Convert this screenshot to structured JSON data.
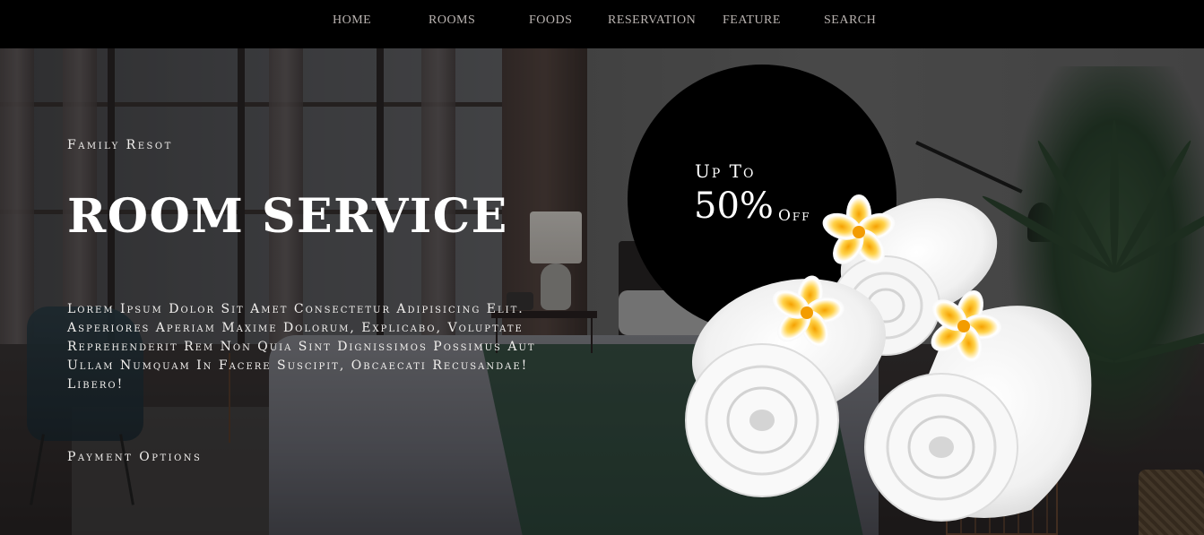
{
  "nav": {
    "items": [
      {
        "label": "HOME"
      },
      {
        "label": "ROOMS"
      },
      {
        "label": "FOODS"
      },
      {
        "label": "RESERVATION"
      },
      {
        "label": "FEATURE"
      },
      {
        "label": "SEARCH"
      }
    ]
  },
  "hero": {
    "eyebrow": "Family Resot",
    "headline": "ROOM SERVICE",
    "body": "Lorem Ipsum Dolor Sit Amet Consectetur Adipisicing Elit. Asperiores Aperiam Maxime Dolorum, Explicabo, Voluptate Reprehenderit Rem Non Quia Sint Dignissimos Possimus Aut Ullam Numquam In Facere Suscipit, Obcaecati Recusandae! Libero!",
    "payment_link": "Payment Options"
  },
  "promo": {
    "up_to": "Up To",
    "percent": "50%",
    "off": "Off"
  },
  "colors": {
    "nav_background": "#000000",
    "nav_text": "#b9b3b0",
    "promo_circle": "#000000",
    "text": "#ffffff"
  },
  "icons": {
    "promo_image": "rolled-towels-with-frangipani-flowers",
    "background_image": "hotel-bedroom-photo"
  }
}
